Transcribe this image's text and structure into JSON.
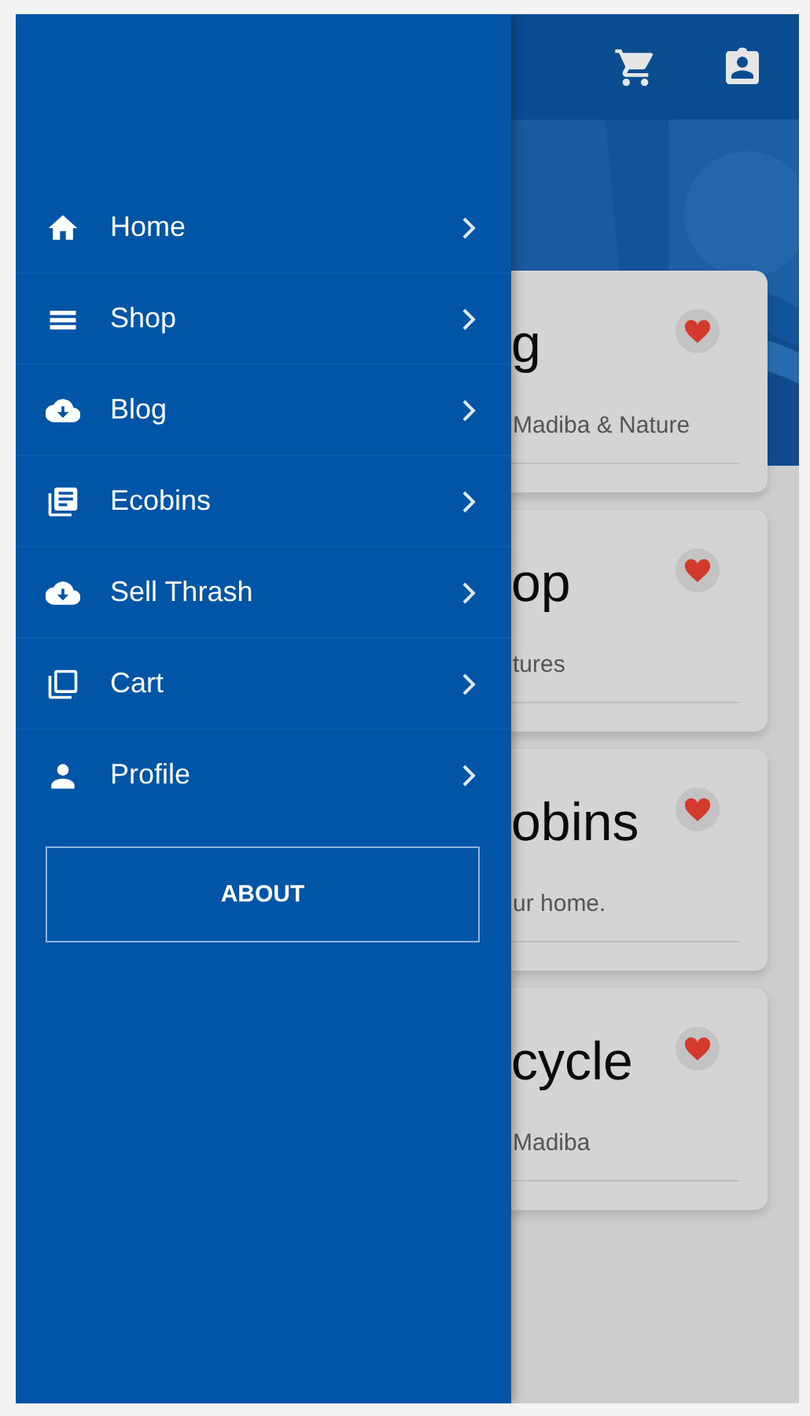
{
  "drawer": {
    "items": [
      {
        "label": "Home"
      },
      {
        "label": "Shop"
      },
      {
        "label": "Blog"
      },
      {
        "label": "Ecobins"
      },
      {
        "label": "Sell Thrash"
      },
      {
        "label": "Cart"
      },
      {
        "label": "Profile"
      }
    ],
    "button": "ABOUT"
  },
  "cards": [
    {
      "title": "g",
      "subtitle": "Madiba & Nature"
    },
    {
      "title": "op",
      "subtitle": "tures"
    },
    {
      "title": "obins",
      "subtitle": "ur home."
    },
    {
      "title": "cycle",
      "subtitle": "Madiba"
    }
  ]
}
